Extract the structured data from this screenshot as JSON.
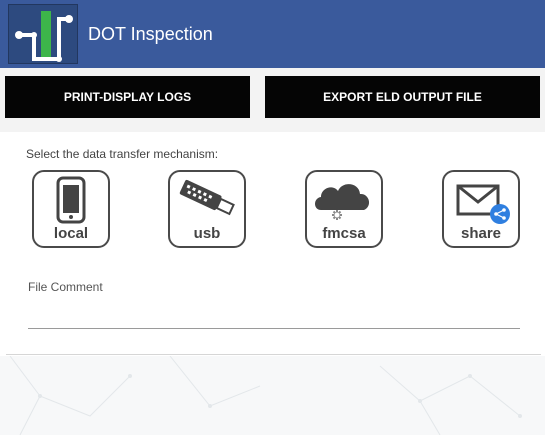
{
  "app": {
    "title": "DOT Inspection"
  },
  "tabs": [
    {
      "label": "PRINT-DISPLAY LOGS"
    },
    {
      "label": "EXPORT ELD OUTPUT FILE"
    }
  ],
  "transfer": {
    "prompt": "Select the data transfer mechanism:",
    "options": [
      {
        "label": "local",
        "icon": "phone-icon"
      },
      {
        "label": "usb",
        "icon": "usb-drive-icon"
      },
      {
        "label": "fmcsa",
        "icon": "cloud-icon"
      },
      {
        "label": "share",
        "icon": "mail-share-icon"
      }
    ]
  },
  "comment": {
    "label": "File Comment",
    "value": ""
  },
  "colors": {
    "appbar": "#3a5a9c",
    "tab": "#050505",
    "accent_green": "#3db54a",
    "share_blue": "#2f7fe0"
  }
}
